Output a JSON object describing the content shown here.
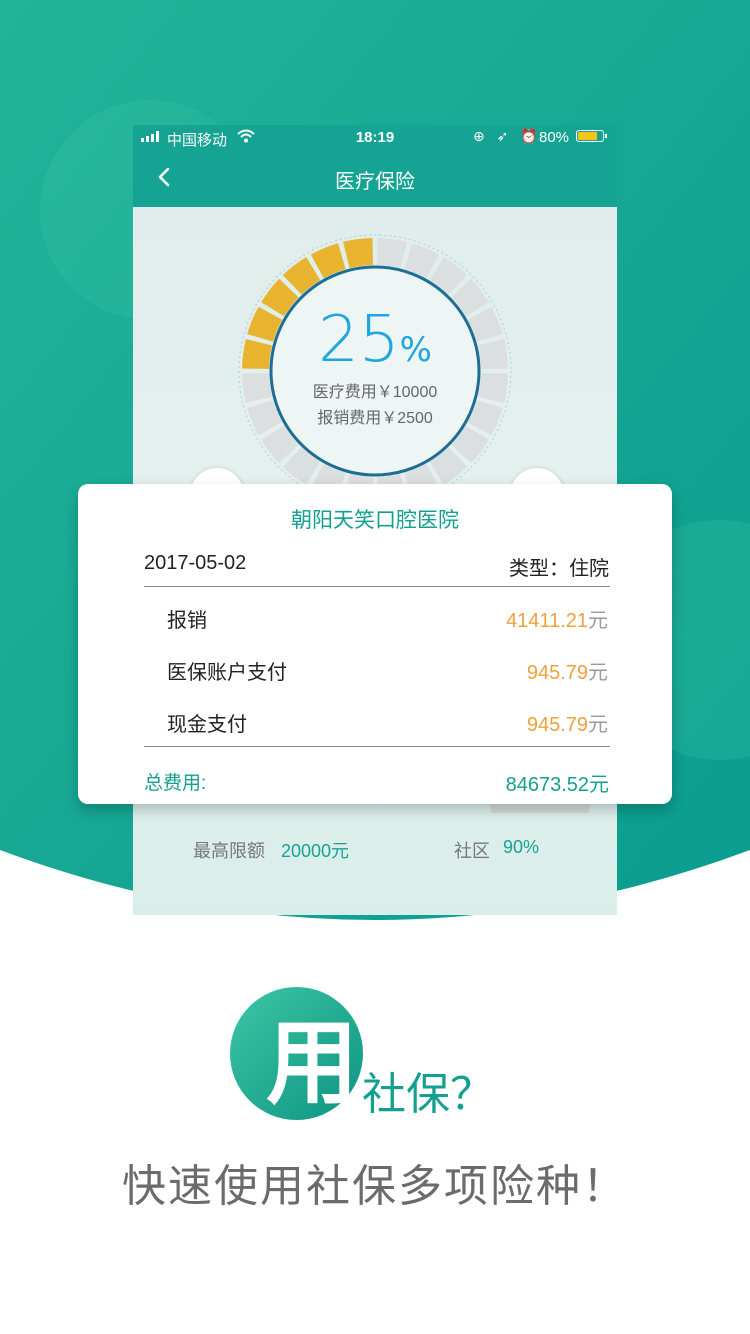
{
  "status_bar": {
    "carrier": "中国移动",
    "time": "18:19",
    "icons": "⊕ ➶ ⏰",
    "battery_percent": "80%",
    "battery_level": 0.8
  },
  "nav": {
    "title": "医疗保险",
    "back_icon": "chevron-left-icon"
  },
  "gauge": {
    "percent_number": "25",
    "percent_sign": "%",
    "progress": 0.25,
    "medical_cost": "医疗费用￥10000",
    "reimbursed": "报销费用￥2500",
    "fill_color": "#e8b430",
    "ring_color": "#1d6e95",
    "number_color": "#1ea6e0"
  },
  "side_left_symbol": "¥",
  "limits": {
    "max_label": "最高限额",
    "max_value": "20000元",
    "community_label": "社区",
    "community_value": "90%"
  },
  "card": {
    "hospital": "朝阳天笑口腔医院",
    "date": "2017-05-02",
    "type": "类型：住院",
    "rows": [
      {
        "label": "报销",
        "value": "41411.21",
        "unit": "元"
      },
      {
        "label": "医保账户支付",
        "value": "945.79",
        "unit": "元"
      },
      {
        "label": "现金支付",
        "value": "945.79",
        "unit": "元"
      }
    ],
    "total_label": "总费用:",
    "total_value": "84673.52元"
  },
  "promo": {
    "big_char": "用",
    "rest": "社保？",
    "slogan": "快速使用社保多项险种！"
  },
  "colors": {
    "brand": "#15a393",
    "accent_orange": "#f0a13c",
    "gauge_yellow": "#e8b430"
  }
}
